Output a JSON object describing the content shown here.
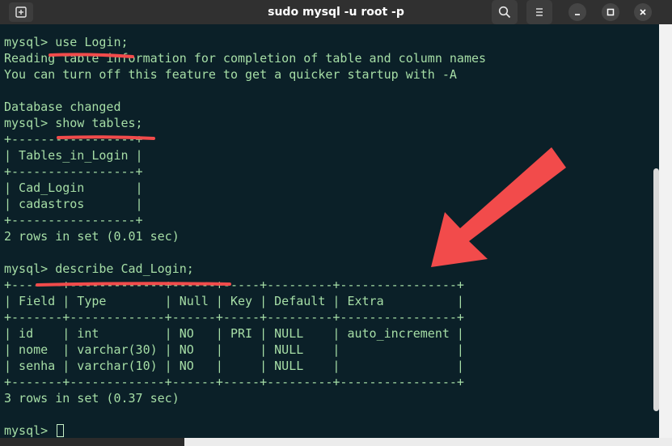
{
  "window": {
    "title": "sudo mysql -u root -p"
  },
  "terminal": {
    "lines": [
      "mysql> use Login;",
      "Reading table information for completion of table and column names",
      "You can turn off this feature to get a quicker startup with -A",
      "",
      "Database changed",
      "mysql> show tables;",
      "+-----------------+",
      "| Tables_in_Login |",
      "+-----------------+",
      "| Cad_Login       |",
      "| cadastros       |",
      "+-----------------+",
      "2 rows in set (0.01 sec)",
      "",
      "mysql> describe Cad_Login;",
      "+-------+-------------+------+-----+---------+----------------+",
      "| Field | Type        | Null | Key | Default | Extra          |",
      "+-------+-------------+------+-----+---------+----------------+",
      "| id    | int         | NO   | PRI | NULL    | auto_increment |",
      "| nome  | varchar(30) | NO   |     | NULL    |                |",
      "| senha | varchar(10) | NO   |     | NULL    |                |",
      "+-------+-------------+------+-----+---------+----------------+",
      "3 rows in set (0.37 sec)",
      ""
    ],
    "prompt": "mysql> "
  },
  "icons": {
    "new_tab": "new-tab-icon",
    "search": "search-icon",
    "menu": "hamburger-menu-icon",
    "minimize": "minimize-icon",
    "maximize": "maximize-icon",
    "close": "close-icon"
  },
  "colors": {
    "terminal_bg": "#0b2028",
    "terminal_text": "#a6dea6",
    "titlebar_bg": "#303030",
    "annotation_red": "#f24b4b"
  }
}
